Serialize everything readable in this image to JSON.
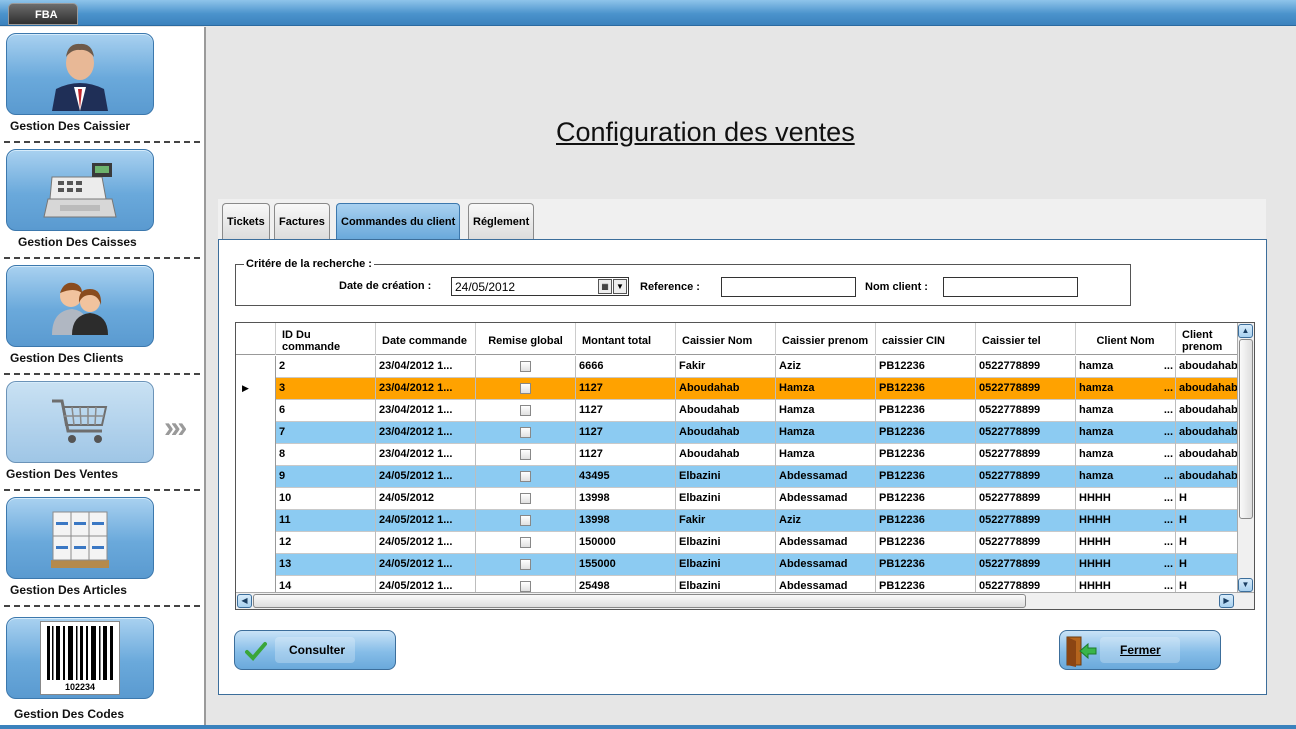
{
  "app_tab": "FBA",
  "sidebar": {
    "items": [
      {
        "label": "Gestion Des Caissier",
        "icon": "cashier-person-icon"
      },
      {
        "label": "Gestion Des Caisses",
        "icon": "cash-register-icon"
      },
      {
        "label": "Gestion Des Clients",
        "icon": "clients-people-icon"
      },
      {
        "label": "Gestion Des Ventes",
        "icon": "shopping-cart-icon"
      },
      {
        "label": "Gestion Des Articles",
        "icon": "boxes-pallet-icon"
      },
      {
        "label": "Gestion Des Codes",
        "icon": "barcode-icon",
        "barcode_number": "102234"
      }
    ]
  },
  "page_title": "Configuration des ventes",
  "tabs": [
    "Tickets",
    "Factures",
    "Commandes du client",
    "Réglement"
  ],
  "active_tab": "Commandes du client",
  "criteria": {
    "legend": "Critére de la recherche :",
    "date_label": "Date de création :",
    "date_value": "24/05/2012",
    "reference_label": "Reference :",
    "reference_value": "",
    "nom_client_label": "Nom client :",
    "nom_client_value": ""
  },
  "grid": {
    "columns": [
      "ID Du commande",
      "Date commande",
      "Remise global",
      "Montant total",
      "Caissier Nom",
      "Caissier prenom",
      "caissier CIN",
      "Caissier tel",
      "Client Nom",
      "Client prenom"
    ],
    "rows": [
      {
        "id": "2",
        "date": "23/04/2012 1...",
        "montant": "6666",
        "cnom": "Fakir",
        "cprenom": "Aziz",
        "cin": "PB12236",
        "tel": "0522778899",
        "clnom": "hamza",
        "clprenom": "aboudahab",
        "style": ""
      },
      {
        "id": "3",
        "date": "23/04/2012 1...",
        "montant": "1127",
        "cnom": "Aboudahab",
        "cprenom": "Hamza",
        "cin": "PB12236",
        "tel": "0522778899",
        "clnom": "hamza",
        "clprenom": "aboudahab",
        "style": "sel"
      },
      {
        "id": "6",
        "date": "23/04/2012 1...",
        "montant": "1127",
        "cnom": "Aboudahab",
        "cprenom": "Hamza",
        "cin": "PB12236",
        "tel": "0522778899",
        "clnom": "hamza",
        "clprenom": "aboudahab",
        "style": ""
      },
      {
        "id": "7",
        "date": "23/04/2012 1...",
        "montant": "1127",
        "cnom": "Aboudahab",
        "cprenom": "Hamza",
        "cin": "PB12236",
        "tel": "0522778899",
        "clnom": "hamza",
        "clprenom": "aboudahab",
        "style": "alt"
      },
      {
        "id": "8",
        "date": "23/04/2012 1...",
        "montant": "1127",
        "cnom": "Aboudahab",
        "cprenom": "Hamza",
        "cin": "PB12236",
        "tel": "0522778899",
        "clnom": "hamza",
        "clprenom": "aboudahab",
        "style": ""
      },
      {
        "id": "9",
        "date": "24/05/2012 1...",
        "montant": "43495",
        "cnom": "Elbazini",
        "cprenom": "Abdessamad",
        "cin": "PB12236",
        "tel": "0522778899",
        "clnom": "hamza",
        "clprenom": "aboudahab",
        "style": "alt"
      },
      {
        "id": "10",
        "date": "24/05/2012",
        "montant": "13998",
        "cnom": "Elbazini",
        "cprenom": "Abdessamad",
        "cin": "PB12236",
        "tel": "0522778899",
        "clnom": "HHHH",
        "clprenom": "H",
        "style": ""
      },
      {
        "id": "11",
        "date": "24/05/2012 1...",
        "montant": "13998",
        "cnom": "Fakir",
        "cprenom": "Aziz",
        "cin": "PB12236",
        "tel": "0522778899",
        "clnom": "HHHH",
        "clprenom": "H",
        "style": "alt"
      },
      {
        "id": "12",
        "date": "24/05/2012 1...",
        "montant": "150000",
        "cnom": "Elbazini",
        "cprenom": "Abdessamad",
        "cin": "PB12236",
        "tel": "0522778899",
        "clnom": "HHHH",
        "clprenom": "H",
        "style": ""
      },
      {
        "id": "13",
        "date": "24/05/2012 1...",
        "montant": "155000",
        "cnom": "Elbazini",
        "cprenom": "Abdessamad",
        "cin": "PB12236",
        "tel": "0522778899",
        "clnom": "HHHH",
        "clprenom": "H",
        "style": "alt"
      },
      {
        "id": "14",
        "date": "24/05/2012 1...",
        "montant": "25498",
        "cnom": "Elbazini",
        "cprenom": "Abdessamad",
        "cin": "PB12236",
        "tel": "0522778899",
        "clnom": "HHHH",
        "clprenom": "H",
        "style": ""
      }
    ]
  },
  "buttons": {
    "consulter": "Consulter",
    "fermer": "Fermer"
  },
  "colors": {
    "accent_blue": "#6aa9db",
    "row_alt": "#8ccbf2",
    "row_selected": "#ffa200"
  }
}
